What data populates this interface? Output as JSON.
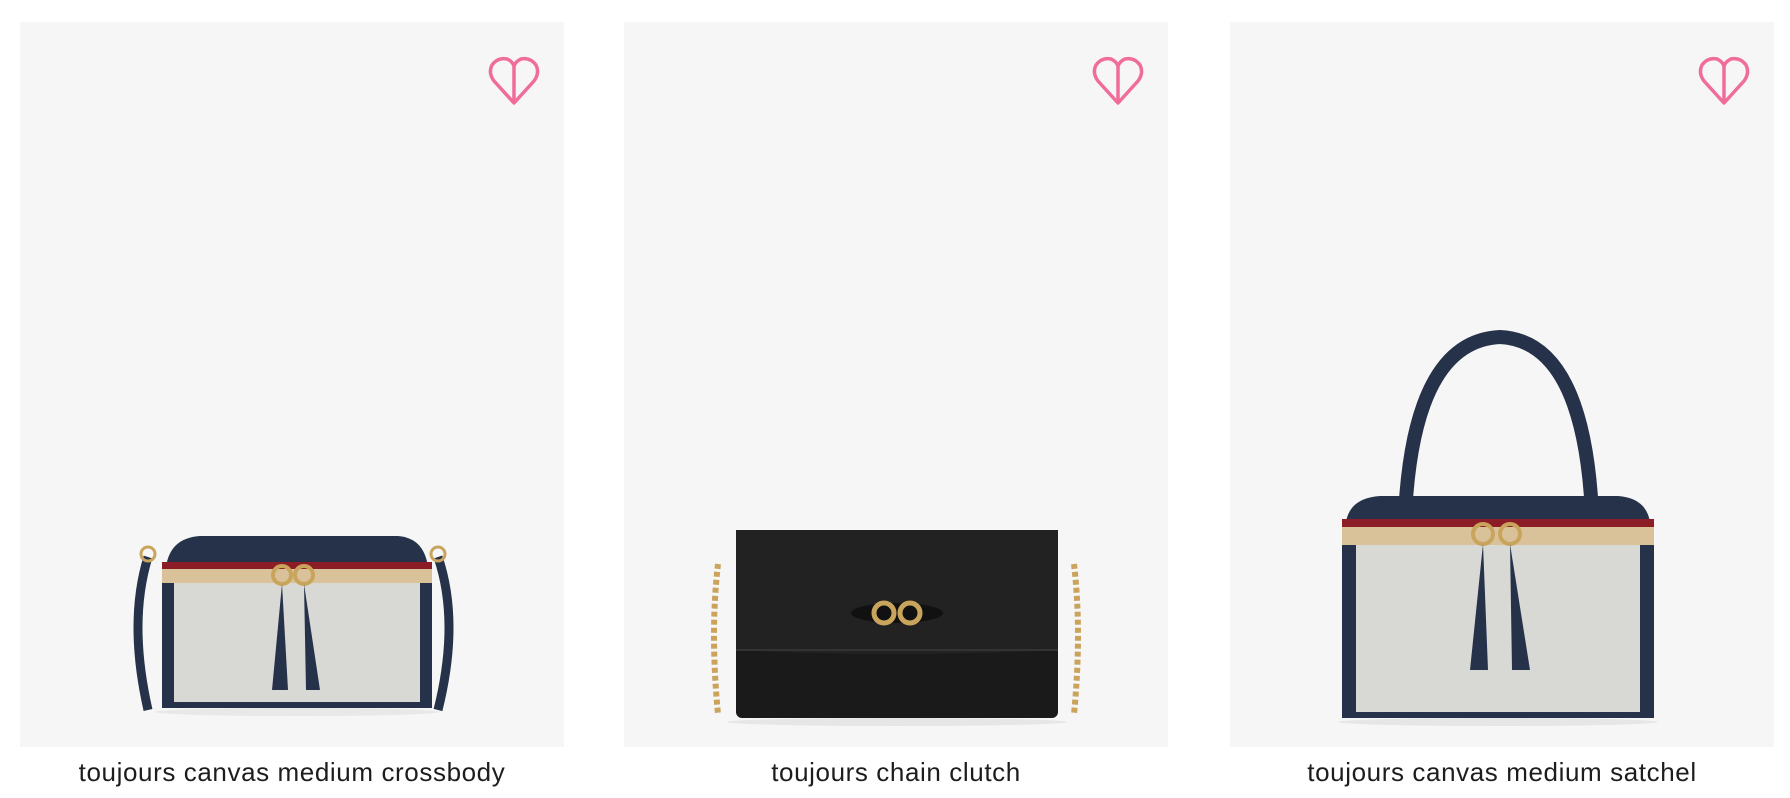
{
  "products": [
    {
      "name": "toujours canvas medium crossbody",
      "wishlist_icon": "heart-outline-icon",
      "image": "canvas-crossbody-bag"
    },
    {
      "name": "toujours chain clutch",
      "wishlist_icon": "heart-outline-icon",
      "image": "black-chain-clutch"
    },
    {
      "name": "toujours canvas medium satchel",
      "wishlist_icon": "heart-outline-icon",
      "image": "canvas-satchel-bag"
    }
  ],
  "colors": {
    "heart": "#f06c9b",
    "card_background": "#f6f6f6",
    "navy": "#26324a",
    "canvas": "#d8d8d4",
    "gold": "#c9a45c",
    "burgundy": "#8c1d26",
    "raffia": "#d9c29a",
    "black": "#1a1a1a"
  }
}
